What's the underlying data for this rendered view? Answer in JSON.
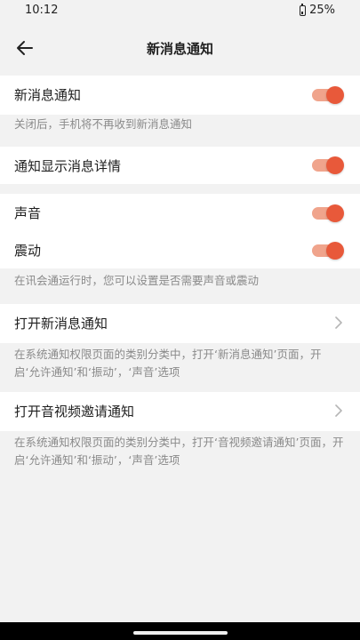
{
  "status": {
    "time": "10:12",
    "battery": "25%"
  },
  "header": {
    "title": "新消息通知",
    "back_icon": "arrow-left-icon"
  },
  "settings": {
    "new_message": {
      "label": "新消息通知",
      "enabled": true,
      "hint": "关闭后，手机将不再收到新消息通知"
    },
    "show_detail": {
      "label": "通知显示消息详情",
      "enabled": true
    },
    "sound": {
      "label": "声音",
      "enabled": true
    },
    "vibrate": {
      "label": "震动",
      "enabled": true,
      "hint": "在讯会通运行时，您可以设置是否需要声音或震动"
    },
    "open_new_message": {
      "label": "打开新消息通知",
      "hint": "在系统通知权限页面的类别分类中，打开‘新消息通知’页面，开启‘允许通知’和‘振动’，‘声音’选项"
    },
    "open_av_invite": {
      "label": "打开音视频邀请通知",
      "hint": "在系统通知权限页面的类别分类中，打开‘音视频邀请通知’页面，开启‘允许通知’和‘振动’，‘声音’选项"
    }
  },
  "colors": {
    "accent": "#e8593a",
    "accent_track": "#f0a48c",
    "background": "#f2f2f2",
    "card": "#ffffff",
    "hint_text": "#8a8a8a"
  }
}
